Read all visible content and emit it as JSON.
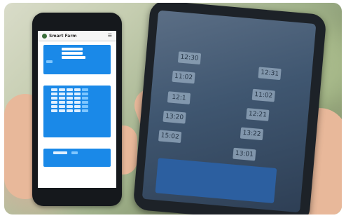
{
  "app": {
    "brand": "Smart Farm",
    "menu_icon": "hamburger-icon"
  },
  "right_phone": {
    "times": [
      "12:30",
      "12:31",
      "11:02",
      "11:02",
      "12:1",
      "12:21",
      "13:20",
      "13:22",
      "15:02",
      "13:01"
    ]
  }
}
